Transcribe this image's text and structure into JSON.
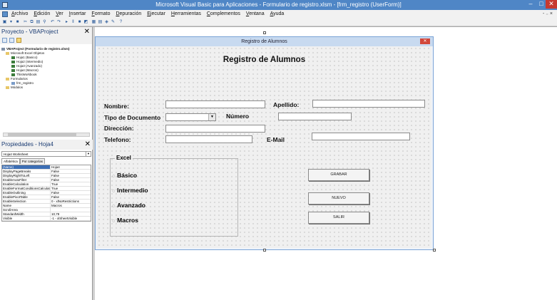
{
  "window": {
    "title": "Microsoft Visual Basic para Aplicaciones - Formulario de registro.xlsm - [frm_registro (UserForm)]",
    "min": "–",
    "max": "□",
    "close": "✕"
  },
  "menu": [
    "Archivo",
    "Edición",
    "Ver",
    "Insertar",
    "Formato",
    "Depuración",
    "Ejecutar",
    "Herramientas",
    "Complementos",
    "Ventana",
    "Ayuda"
  ],
  "menu_mdi_controls": "- ₋ ×",
  "project_pane": {
    "title": "Proyecto - VBAProject",
    "close": "✕",
    "tree": [
      {
        "label": "VBAProject (Formulario de registro.xlsm)",
        "icon": "project-icon"
      },
      {
        "label": "Microsoft Excel Objetos",
        "icon": "folder-icon"
      },
      {
        "label": "Hoja1 (Basico)",
        "icon": "sheet-icon"
      },
      {
        "label": "Hoja2 (Intermedio)",
        "icon": "sheet-icon"
      },
      {
        "label": "Hoja3 (Avanzado)",
        "icon": "sheet-icon"
      },
      {
        "label": "Hoja4 (Macros)",
        "icon": "sheet-icon"
      },
      {
        "label": "ThisWorkbook",
        "icon": "sheet-icon"
      },
      {
        "label": "Formularios",
        "icon": "folder-icon"
      },
      {
        "label": "frm_registro",
        "icon": "form-icon"
      },
      {
        "label": "Módulos",
        "icon": "folder-icon"
      }
    ]
  },
  "properties_pane": {
    "title": "Propiedades - Hoja4",
    "close": "✕",
    "object": "Hoja4 Worksheet",
    "tabs": [
      "Alfabética",
      "Por categorías"
    ],
    "rows": [
      {
        "k": "(Name)",
        "v": "Hoja4"
      },
      {
        "k": "DisplayPageBreaks",
        "v": "False"
      },
      {
        "k": "DisplayRightToLeft",
        "v": "False"
      },
      {
        "k": "EnableAutoFilter",
        "v": "False"
      },
      {
        "k": "EnableCalculation",
        "v": "True"
      },
      {
        "k": "EnableFormatConditionsCalculation",
        "v": "True"
      },
      {
        "k": "EnableOutlining",
        "v": "False"
      },
      {
        "k": "EnablePivotTable",
        "v": "False"
      },
      {
        "k": "EnableSelection",
        "v": "0 - xlNoRestrictions"
      },
      {
        "k": "Name",
        "v": "Macros"
      },
      {
        "k": "ScrollArea",
        "v": ""
      },
      {
        "k": "StandardWidth",
        "v": "10,78"
      },
      {
        "k": "Visible",
        "v": "-1 - xlSheetVisible"
      }
    ]
  },
  "form": {
    "caption": "Registro de Alumnos",
    "heading": "Registro de Alumnos",
    "close": "✕",
    "labels": {
      "nombre": "Nombre:",
      "apellido": "Apellido:",
      "tipo_documento": "Tipo de Documento",
      "numero": "Número",
      "direccion": "Dirección:",
      "telefono": "Telefono:",
      "email": "E-Mail"
    },
    "frame": {
      "caption": "Excel",
      "options": [
        "Básico",
        "Intermedio",
        "Avanzado",
        "Macros"
      ]
    },
    "buttons": {
      "grabar": "GRABAR",
      "nuevo": "NUEVO",
      "salir": "SALIR"
    }
  }
}
